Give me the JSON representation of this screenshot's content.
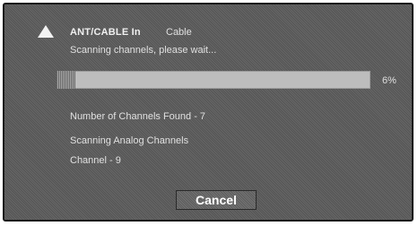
{
  "header": {
    "icon": "up-arrow-icon",
    "input_label": "ANT/CABLE In",
    "input_value": "Cable"
  },
  "status": {
    "message": "Scanning channels, please wait..."
  },
  "progress": {
    "fraction": 0.06,
    "percent_label": "6%"
  },
  "scan": {
    "channels_found": "Number of Channels Found -  7",
    "mode": "Scanning Analog Channels",
    "channel": "Channel  -  9"
  },
  "buttons": {
    "cancel_label": "Cancel"
  },
  "colors": {
    "panel": "#5e5e5e",
    "progress_track": "#bdbdbd",
    "text": "#e0e0e0"
  }
}
